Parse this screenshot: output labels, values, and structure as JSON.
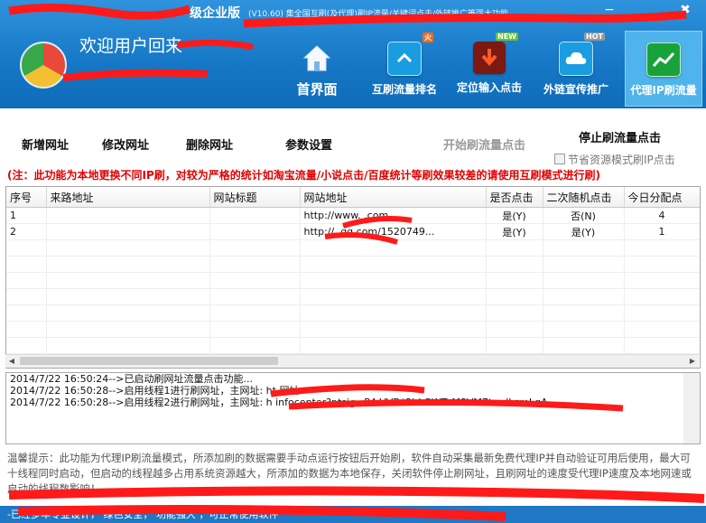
{
  "window": {
    "title": "级企业版",
    "subtitle": "(V10.60)  集全国互刷(及代理)刷IP流量/关键词点击/外链推广等强大功能",
    "min_label": "−",
    "close_label": "✖"
  },
  "header": {
    "welcome": "欢迎用户回来"
  },
  "nav": [
    {
      "label": "首界面",
      "icon": "home-icon"
    },
    {
      "label": "互刷流量排名",
      "icon": "swap-icon",
      "badge": "火",
      "badge_color": "#f06a1c"
    },
    {
      "label": "定位输入点击",
      "icon": "target-icon",
      "badge": "NEW",
      "badge_color": "#6bc232"
    },
    {
      "label": "外链宣传推广",
      "icon": "cloud-icon",
      "badge": "HOT",
      "badge_color": "#999999"
    },
    {
      "label": "代理IP刷流量",
      "icon": "chart-icon"
    }
  ],
  "toolbar": {
    "add": "新增网址",
    "edit": "修改网址",
    "delete": "删除网址",
    "settings": "参数设置",
    "start": "开始刷流量点击",
    "stop": "停止刷流量点击",
    "save_mode": "节省资源模式刷IP点击"
  },
  "note": "(注：此功能为本地更换不同IP刷，对较为严格的统计如淘宝流量/小说点击/百度统计等刷效果较差的请使用互刷模式进行刷)",
  "table": {
    "headers": [
      "序号",
      "来路地址",
      "网站标题",
      "网站地址",
      "是否点击",
      "二次随机点击",
      "今日分配点"
    ],
    "rows": [
      [
        "1",
        "",
        "",
        "http://www.        .com",
        "是(Y)",
        "否(N)",
        "4"
      ],
      [
        "2",
        "",
        "",
        "http://          .qq.com/1520749...",
        "是(Y)",
        "是(Y)",
        "1"
      ]
    ]
  },
  "log": [
    "2014/7/22 16:50:24-->已启动刷网址流量点击功能...",
    "2014/7/22 16:50:28-->启用线程1进行刷网址，主网址:  ht                              网址: -",
    "2014/7/22 16:50:28-->启用线程2进行刷网址，主网址:  h                                 infocenter?ptsig=P4-VVD*2bLGWToM8VM7terdLzmLqA"
  ],
  "tips": "温馨提示：此功能为代理IP刷流量模式，所添加刷的数据需要手动点运行按钮后开始刷，软件自动采集最新免费代理IP并自动验证可用后使用，最大可十线程同时启动，但启动的线程越多占用系统资源越大，所添加的数据为本地保存，关闭软件停止刷网址，且刷网址的速度受代理IP速度及本地网速或启动的线程数影响！",
  "status": "-已经多年专业设计，   绿色安全，  功能强大                                                                                         ，可正常使用软件"
}
